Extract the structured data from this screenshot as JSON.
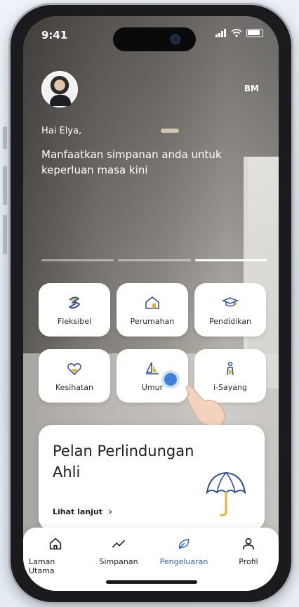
{
  "status": {
    "time": "9:41"
  },
  "profile": {
    "initials": "BM"
  },
  "greeting": "Hai Elya,",
  "tagline": "Manfaatkan simpanan anda untuk keperluan masa kini",
  "carousel": {
    "segments": 3,
    "active_index": 2
  },
  "categories": [
    {
      "label": "Fleksibel",
      "icon": "flexible-icon"
    },
    {
      "label": "Perumahan",
      "icon": "house-icon"
    },
    {
      "label": "Pendidikan",
      "icon": "graduation-cap-icon"
    },
    {
      "label": "Kesihatan",
      "icon": "heart-health-icon"
    },
    {
      "label": "Umur",
      "icon": "sailboat-icon"
    },
    {
      "label": "i-Sayang",
      "icon": "family-icon"
    }
  ],
  "promo_card": {
    "title": "Pelan Perlindungan Ahli",
    "link_label": "Lihat lanjut",
    "icon": "umbrella-icon"
  },
  "nav": [
    {
      "label": "Laman Utama",
      "icon": "home-icon"
    },
    {
      "label": "Simpanan",
      "icon": "trend-line-icon"
    },
    {
      "label": "Pengeluaran",
      "icon": "leaf-icon",
      "active": true
    },
    {
      "label": "Profil",
      "icon": "user-icon"
    }
  ],
  "colors": {
    "accent": "#2f63c1",
    "icon_gold": "#e5b43a",
    "icon_blue": "#2e4f8c"
  }
}
